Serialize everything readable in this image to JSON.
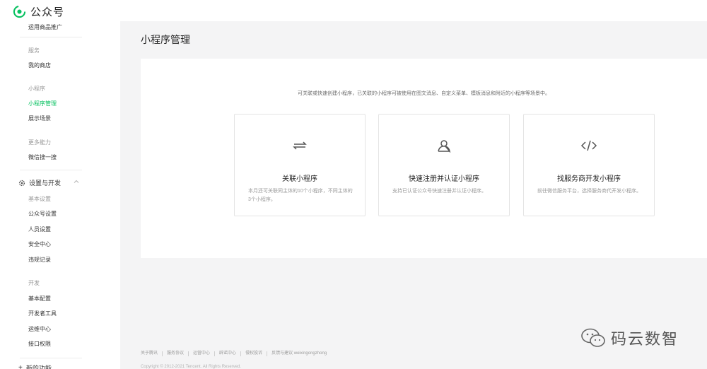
{
  "app": {
    "title": "公众号"
  },
  "sidebar": {
    "items": [
      {
        "label": "运用商品推广",
        "type": "item"
      },
      {
        "label": "服务",
        "type": "category"
      },
      {
        "label": "我的商店",
        "type": "item"
      },
      {
        "label": "小程序",
        "type": "category"
      },
      {
        "label": "小程序管理",
        "type": "active"
      },
      {
        "label": "展示场景",
        "type": "item"
      },
      {
        "label": "更多能力",
        "type": "category"
      },
      {
        "label": "微信搜一搜",
        "type": "item"
      }
    ],
    "group": {
      "label": "设置与开发"
    },
    "group_items": [
      {
        "label": "基本设置",
        "type": "category"
      },
      {
        "label": "公众号设置",
        "type": "item"
      },
      {
        "label": "人员设置",
        "type": "item"
      },
      {
        "label": "安全中心",
        "type": "item"
      },
      {
        "label": "违规记录",
        "type": "item"
      },
      {
        "label": "开发",
        "type": "category"
      },
      {
        "label": "基本配置",
        "type": "item"
      },
      {
        "label": "开发者工具",
        "type": "item"
      },
      {
        "label": "运维中心",
        "type": "item"
      },
      {
        "label": "接口权限",
        "type": "item"
      }
    ],
    "bottom_label": "新的功能"
  },
  "main": {
    "page_title": "小程序管理",
    "description": "可关联或快速创建小程序，已关联的小程序可被使用在图文消息、自定义菜单、模板消息和附近的小程序等场景中。",
    "cards": [
      {
        "icon": "link-arrows-icon",
        "title": "关联小程序",
        "desc": "本月还可关联同主体的10个小程序，不同主体的3个小程序。"
      },
      {
        "icon": "user-icon",
        "title": "快速注册并认证小程序",
        "desc": "支持已认证公众号快速注册并认证小程序。"
      },
      {
        "icon": "code-icon",
        "title": "找服务商开发小程序",
        "desc": "前往微信服务平台，选择服务商代开发小程序。"
      }
    ]
  },
  "footer": {
    "links": [
      "关于腾讯",
      "服务协议",
      "运营中心",
      "辟谣中心",
      "侵权投诉",
      "反馈与建议 weixingongzhong"
    ],
    "copyright": "Copyright © 2012-2021 Tencent. All Rights Reserved."
  },
  "watermark": {
    "text": "码云数智"
  },
  "colors": {
    "accent": "#07c160",
    "background": "#f4f4f5"
  }
}
